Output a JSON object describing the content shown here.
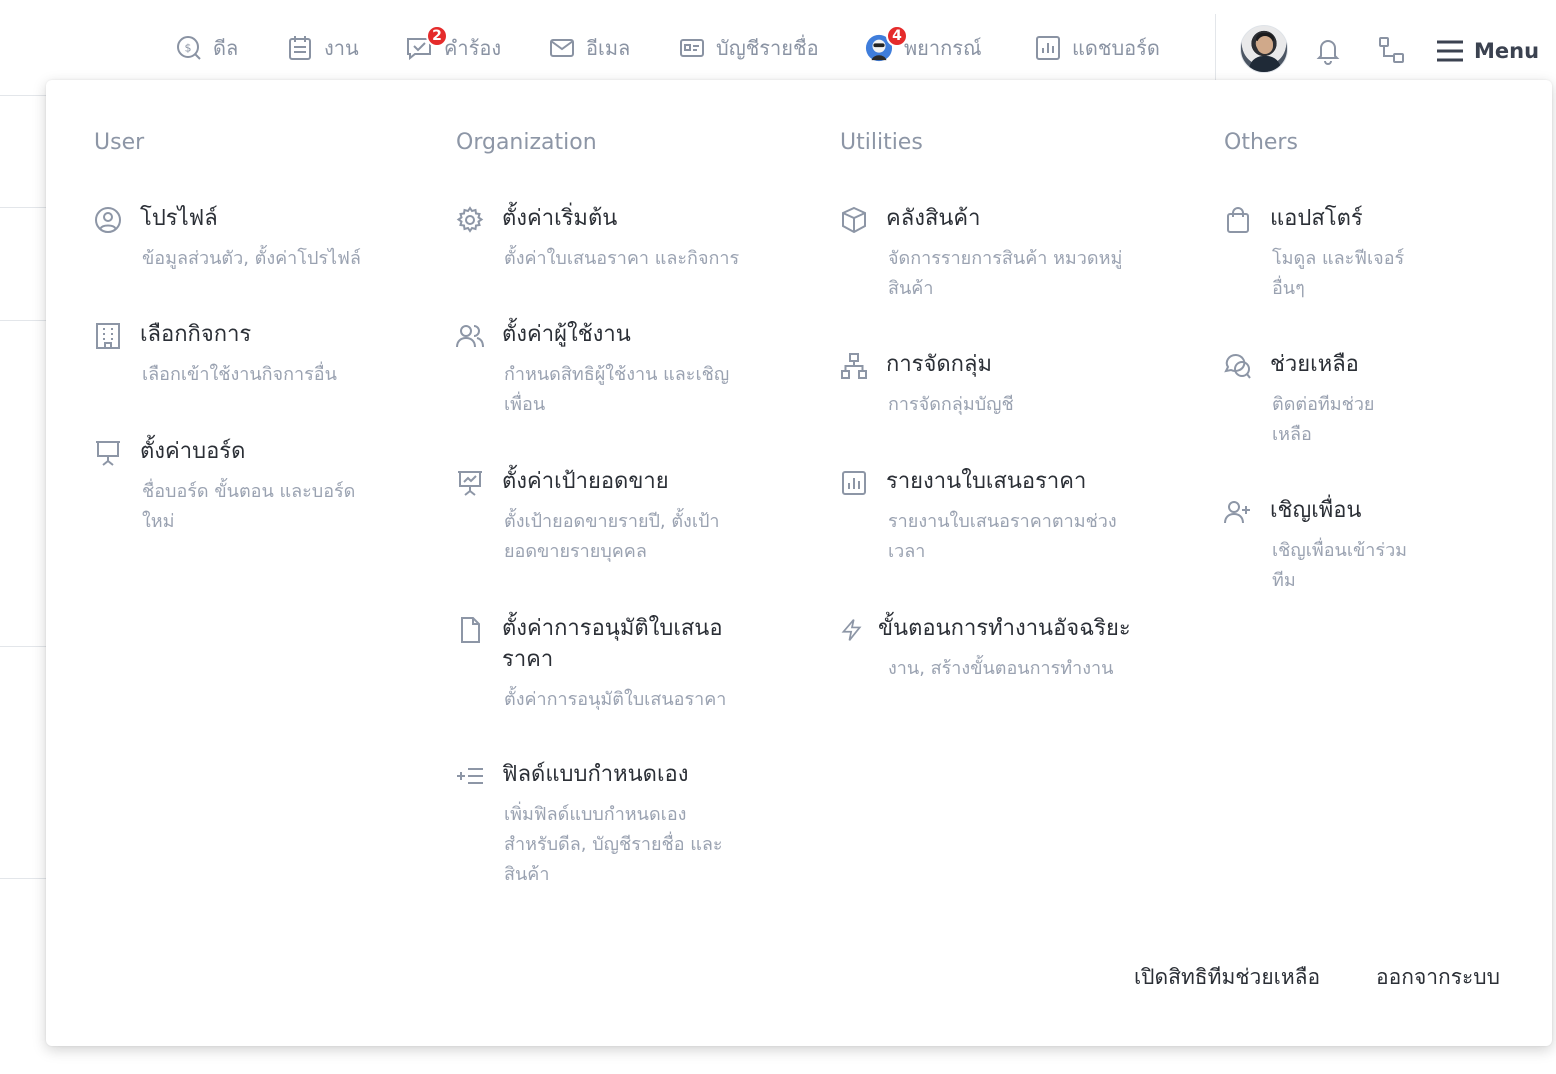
{
  "nav": {
    "items": [
      {
        "label": "ดีล",
        "icon": "deal-icon"
      },
      {
        "label": "งาน",
        "icon": "task-icon"
      },
      {
        "label": "คำร้อง",
        "icon": "request-icon",
        "badge": "2"
      },
      {
        "label": "อีเมล",
        "icon": "mail-icon"
      },
      {
        "label": "บัญชีรายชื่อ",
        "icon": "contact-card-icon"
      },
      {
        "label": "พยากรณ์",
        "icon": "forecast-avatar-icon",
        "badge": "4"
      },
      {
        "label": "แดชบอร์ด",
        "icon": "dashboard-icon"
      }
    ],
    "menu_label": "Menu"
  },
  "menu": {
    "columns": [
      {
        "title": "User",
        "items": [
          {
            "title": "โปรไฟล์",
            "desc": [
              "ข้อมูลส่วนตัว, ตั้งค่าโปรไฟล์"
            ],
            "icon": "user-circle-icon"
          },
          {
            "title": "เลือกกิจการ",
            "desc": [
              "เลือกเข้าใช้งานกิจการอื่น"
            ],
            "icon": "building-icon"
          },
          {
            "title": "ตั้งค่าบอร์ด",
            "desc": [
              "ชื่อบอร์ด ขั้นตอน และบอร์ด",
              "ใหม่"
            ],
            "icon": "presentation-board-icon"
          }
        ]
      },
      {
        "title": "Organization",
        "items": [
          {
            "title": "ตั้งค่าเริ่มต้น",
            "desc": [
              "ตั้งค่าใบเสนอราคา และกิจการ"
            ],
            "icon": "gear-icon"
          },
          {
            "title": "ตั้งค่าผู้ใช้งาน",
            "desc": [
              "กำหนดสิทธิผู้ใช้งาน และเชิญ",
              "เพื่อน"
            ],
            "icon": "users-icon"
          },
          {
            "title": "ตั้งค่าเป้ายอดขาย",
            "desc": [
              "ตั้งเป้ายอดขายรายปี, ตั้งเป้า",
              "ยอดขายรายบุคคล"
            ],
            "icon": "sales-target-icon"
          },
          {
            "title": "ตั้งค่าการอนุมัติใบเสนอ",
            "title2": "ราคา",
            "desc": [
              "ตั้งค่าการอนุมัติใบเสนอราคา"
            ],
            "icon": "document-icon"
          },
          {
            "title": "ฟิลด์แบบกำหนดเอง",
            "desc": [
              "เพิ่มฟิลด์แบบกำหนดเอง",
              "สำหรับดีล, บัญชีรายชื่อ และ",
              "สินค้า"
            ],
            "icon": "add-list-icon"
          }
        ]
      },
      {
        "title": "Utilities",
        "items": [
          {
            "title": "คลังสินค้า",
            "desc": [
              "จัดการรายการสินค้า หมวดหมู่",
              "สินค้า"
            ],
            "icon": "box-icon"
          },
          {
            "title": "การจัดกลุ่ม",
            "desc": [
              "การจัดกลุ่มบัญชี"
            ],
            "icon": "hierarchy-icon"
          },
          {
            "title": "รายงานใบเสนอราคา",
            "desc": [
              "รายงานใบเสนอราคาตามช่วง",
              "เวลา"
            ],
            "icon": "bar-chart-icon"
          },
          {
            "title": "ขั้นตอนการทำงานอัจฉริยะ",
            "desc": [
              "งาน, สร้างขั้นตอนการทำงาน"
            ],
            "icon": "lightning-icon"
          }
        ]
      },
      {
        "title": "Others",
        "items": [
          {
            "title": "แอปสโตร์",
            "desc": [
              "โมดูล และฟีเจอร์",
              "อื่นๆ"
            ],
            "icon": "shopping-bag-icon"
          },
          {
            "title": "ช่วยเหลือ",
            "desc": [
              "ติดต่อทีมช่วย",
              "เหลือ"
            ],
            "icon": "chat-bubbles-icon"
          },
          {
            "title": "เชิญเพื่อน",
            "desc": [
              "เชิญเพื่อนเข้าร่วม",
              "ทีม"
            ],
            "icon": "user-plus-icon"
          }
        ]
      }
    ],
    "footer": {
      "support_access": "เปิดสิทธิทีมช่วยเหลือ",
      "logout": "ออกจากระบบ"
    }
  }
}
